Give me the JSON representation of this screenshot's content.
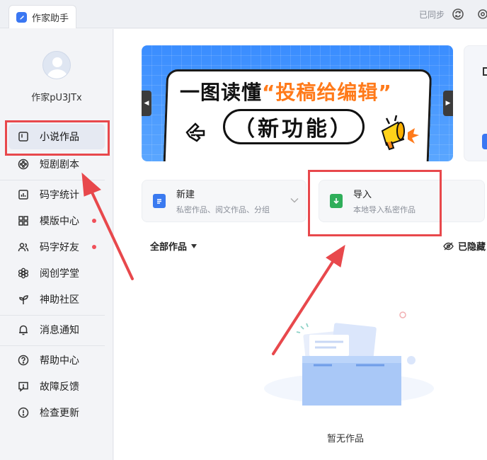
{
  "app": {
    "tab_title": "作家助手",
    "sync_status": "已同步"
  },
  "sidebar": {
    "username": "作家pU3JTx",
    "items": [
      {
        "label": "小说作品",
        "icon": "book-icon",
        "active": true,
        "dot": false
      },
      {
        "label": "短剧剧本",
        "icon": "film-reel-icon",
        "active": false,
        "dot": false
      },
      {
        "label": "码字统计",
        "icon": "bar-chart-icon",
        "active": false,
        "dot": false
      },
      {
        "label": "模版中心",
        "icon": "grid-icon",
        "active": false,
        "dot": true
      },
      {
        "label": "码字好友",
        "icon": "users-icon",
        "active": false,
        "dot": true
      },
      {
        "label": "阅创学堂",
        "icon": "flower-icon",
        "active": false,
        "dot": false
      },
      {
        "label": "神助社区",
        "icon": "sprout-icon",
        "active": false,
        "dot": false
      },
      {
        "label": "消息通知",
        "icon": "bell-icon",
        "active": false,
        "dot": false
      },
      {
        "label": "帮助中心",
        "icon": "help-circle-icon",
        "active": false,
        "dot": false
      },
      {
        "label": "故障反馈",
        "icon": "feedback-icon",
        "active": false,
        "dot": false
      },
      {
        "label": "检查更新",
        "icon": "alert-circle-icon",
        "active": false,
        "dot": false
      }
    ]
  },
  "banner": {
    "line1_prefix": "一图读懂",
    "line1_highlight": "“投稿给编辑”",
    "line2": "（新功能）"
  },
  "actions": {
    "new": {
      "title": "新建",
      "desc": "私密作品、阅文作品、分组"
    },
    "import": {
      "title": "导入",
      "desc": "本地导入私密作品"
    }
  },
  "works": {
    "filter_label": "全部作品",
    "hidden_label": "已隐藏",
    "empty_text": "暂无作品"
  },
  "colors": {
    "accent": "#3a77f2",
    "annotation": "#e8484c",
    "dot": "#f0505a"
  }
}
